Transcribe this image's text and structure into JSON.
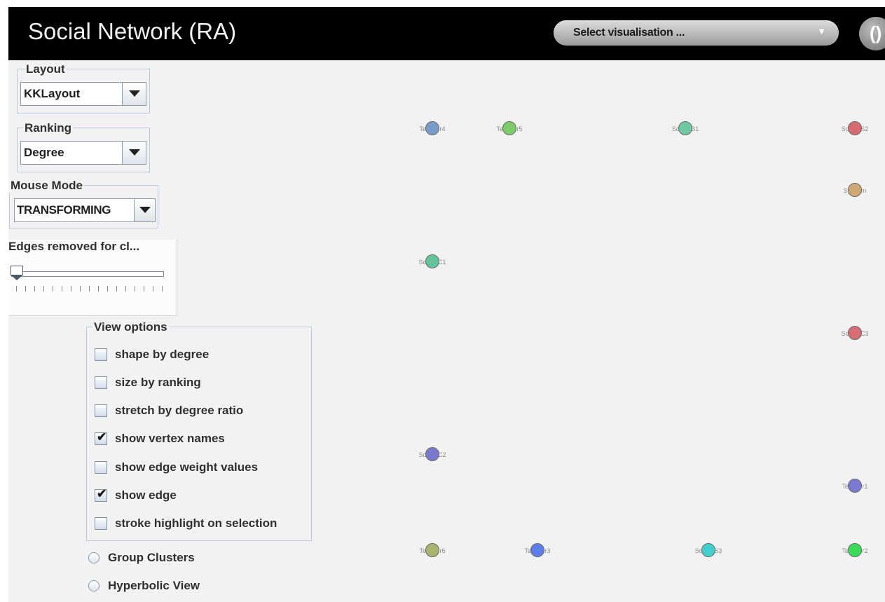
{
  "header": {
    "title": "Social Network (RA)",
    "visualisation_select": {
      "value": "Select visualisation ...",
      "arrow": "▼"
    },
    "refresh_label": "()"
  },
  "controls": {
    "layout": {
      "title": "Layout",
      "value": "KKLayout"
    },
    "ranking": {
      "title": "Ranking",
      "value": "Degree"
    },
    "mouse_mode": {
      "title": "Mouse Mode",
      "value": "TRANSFORMING"
    },
    "edges_slider": {
      "title": "Edges removed for cl...",
      "value": 0
    }
  },
  "view_options": {
    "title": "View options",
    "items": [
      {
        "label": "shape by degree",
        "checked": false
      },
      {
        "label": "size by ranking",
        "checked": false
      },
      {
        "label": "stretch by degree ratio",
        "checked": false
      },
      {
        "label": "show vertex names",
        "checked": true
      },
      {
        "label": "show edge weight values",
        "checked": false
      },
      {
        "label": "show edge",
        "checked": true
      },
      {
        "label": "stroke highlight on selection",
        "checked": false
      }
    ]
  },
  "radios": [
    {
      "label": "Group Clusters",
      "selected": false
    },
    {
      "label": "Hyperbolic View",
      "selected": false
    }
  ],
  "graph": {
    "vertices": [
      {
        "label": "Teacher4",
        "color": "#7a9cc8"
      },
      {
        "label": "Teacher5",
        "color": "#7ccd6a"
      },
      {
        "label": "SchoolB1",
        "color": "#6ec8a0"
      },
      {
        "label": "SchoolS2",
        "color": "#d86a72"
      },
      {
        "label": "Sysadm",
        "color": "#cfa875"
      },
      {
        "label": "SchoolC1",
        "color": "#63c39a"
      },
      {
        "label": "SchoolC3",
        "color": "#d76d75"
      },
      {
        "label": "SchoolC2",
        "color": "#7878cc"
      },
      {
        "label": "Teacher1",
        "color": "#7a7ad2"
      },
      {
        "label": "Teacher6",
        "color": "#aab46e"
      },
      {
        "label": "Teacher3",
        "color": "#5b7ee8"
      },
      {
        "label": "SchoolS3",
        "color": "#42cfcf"
      },
      {
        "label": "Teacher2",
        "color": "#38dc58"
      }
    ]
  }
}
